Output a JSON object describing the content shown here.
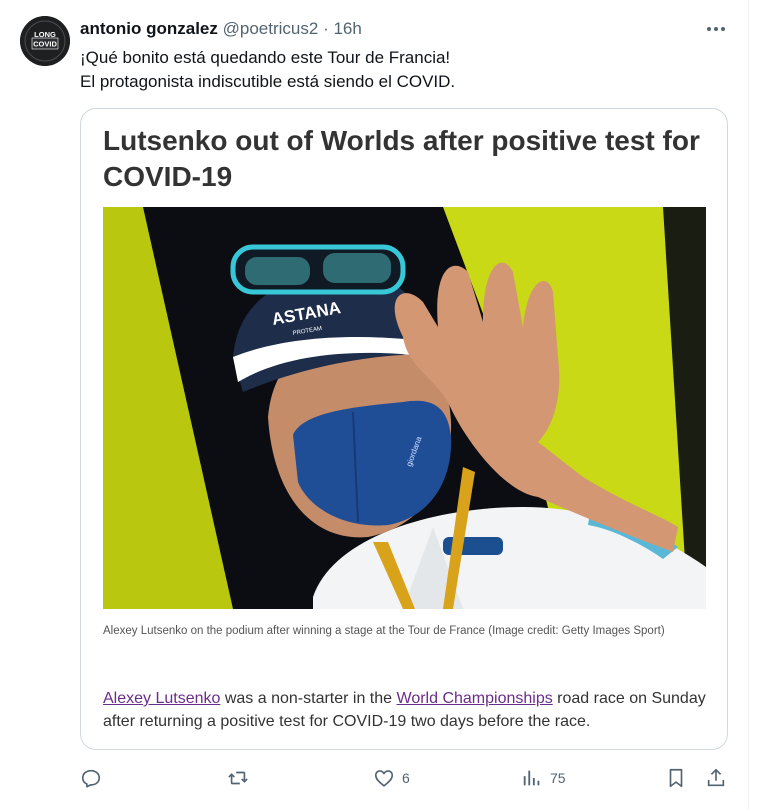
{
  "tweet": {
    "author_name": "antonio gonzalez",
    "handle": "@poetricus2",
    "separator": "·",
    "time": "16h",
    "avatar_text": [
      "LONG",
      "COVID"
    ],
    "text_lines": [
      "¡Qué bonito está quedando este Tour de Francia!",
      "El protagonista indiscutible está siendo el COVID."
    ]
  },
  "card": {
    "headline": "Lutsenko out of Worlds after positive test for COVID-19",
    "image_text": [
      "ASTANA",
      "PROTEAM",
      "giordana"
    ],
    "caption": "Alexey Lutsenko on the podium after winning a stage at the Tour de France (Image credit: Getty Images Sport)",
    "body_link_1": "Alexey Lutsenko",
    "body_text_1": " was a non-starter in the ",
    "body_link_2": "World Championships",
    "body_text_2": " road race on Sunday after returning a positive test for COVID-19 two days before the race."
  },
  "actions": {
    "reply_count": "",
    "retweet_count": "",
    "like_count": "6",
    "views_count": "75"
  },
  "icons": {
    "more": "more-dots-icon",
    "reply": "reply-icon",
    "retweet": "retweet-icon",
    "like": "heart-icon",
    "views": "views-icon",
    "bookmark": "bookmark-icon",
    "share": "share-icon"
  },
  "colors": {
    "text": "#0f1419",
    "secondary": "#536471",
    "border": "#cfd9de",
    "link": "#6b2d8a",
    "photo_yellow": "#c9d916"
  }
}
